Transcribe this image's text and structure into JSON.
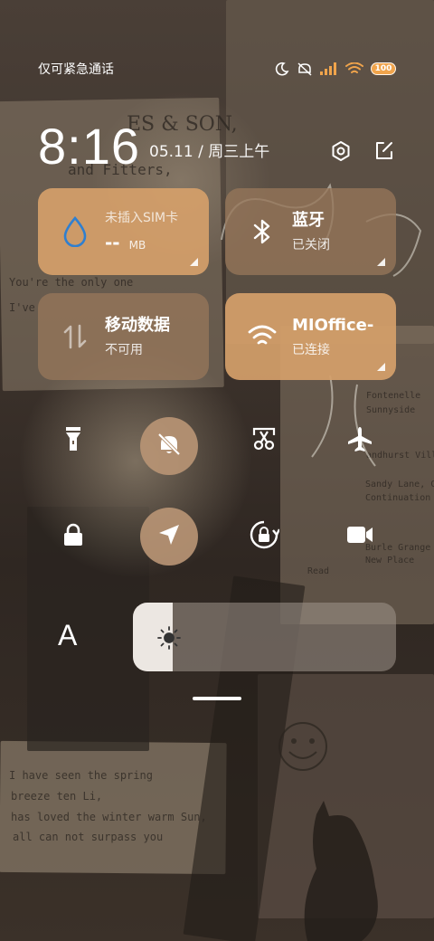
{
  "status_bar": {
    "carrier": "仅可紧急通话",
    "icons": [
      "moon-icon",
      "mute-icon",
      "signal-icon",
      "wifi-icon"
    ],
    "battery": "100"
  },
  "header": {
    "time": "8:16",
    "date": "05.11 / 周三上午",
    "icons": [
      "settings-icon",
      "edit-icon"
    ]
  },
  "tiles": [
    {
      "title": "未插入SIM卡",
      "value": "--",
      "unit": "MB",
      "icon": "water-drop-icon",
      "state": "on"
    },
    {
      "title": "蓝牙",
      "subtitle": "已关闭",
      "icon": "bluetooth-icon",
      "state": "off"
    },
    {
      "title": "移动数据",
      "subtitle": "不可用",
      "icon": "data-arrows-icon",
      "state": "off"
    },
    {
      "title": "MIOffice-",
      "subtitle": "已连接",
      "icon": "wifi-icon",
      "state": "on"
    }
  ],
  "toggles_row1": [
    {
      "name": "flashlight",
      "icon": "flashlight-icon",
      "active": false
    },
    {
      "name": "silent",
      "icon": "bell-off-icon",
      "active": true
    },
    {
      "name": "screenshot",
      "icon": "scissors-icon",
      "active": false
    },
    {
      "name": "airplane",
      "icon": "airplane-icon",
      "active": false
    }
  ],
  "toggles_row2": [
    {
      "name": "lock",
      "icon": "lock-icon",
      "active": false
    },
    {
      "name": "location",
      "icon": "location-icon",
      "active": true
    },
    {
      "name": "rotation-lock",
      "icon": "rotation-lock-icon",
      "active": false
    },
    {
      "name": "screen-record",
      "icon": "video-camera-icon",
      "active": false
    }
  ],
  "brightness": {
    "font_label": "A",
    "level": 0.15
  },
  "colors": {
    "tile_on": "#d59f6a",
    "tile_off": "#96765a",
    "toggle_active": "#b79474"
  }
}
